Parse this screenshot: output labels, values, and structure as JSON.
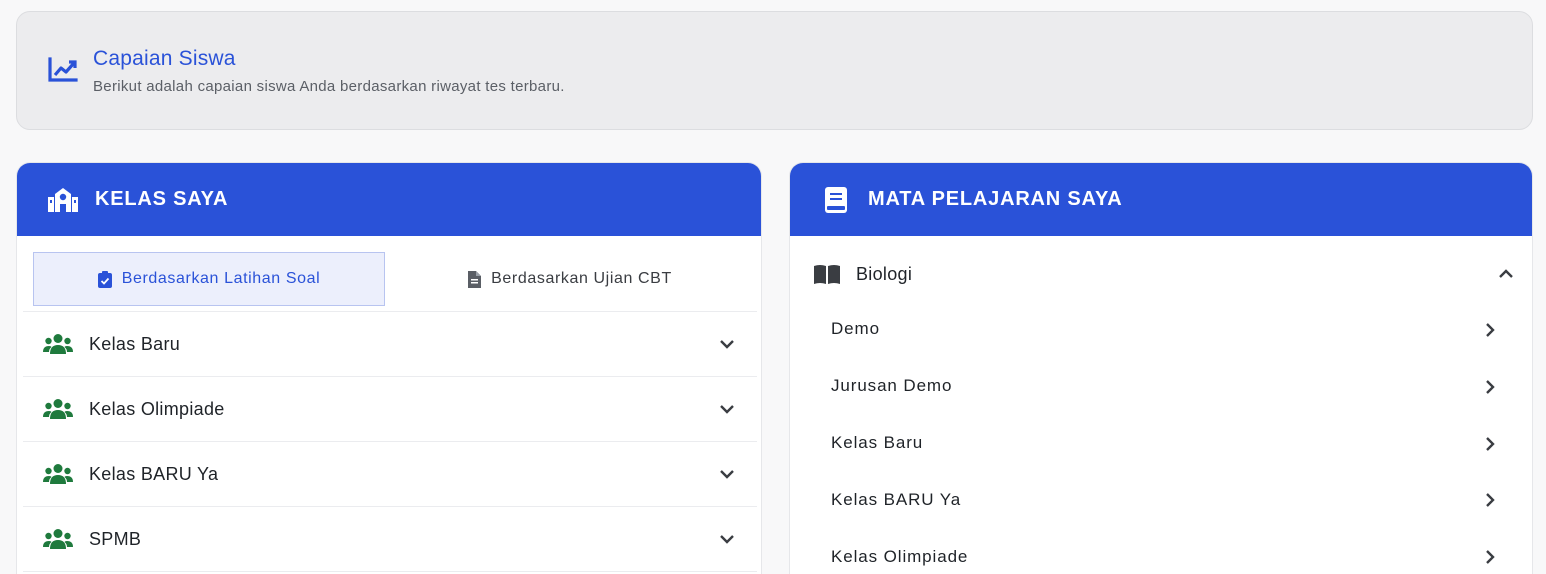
{
  "banner": {
    "icon": "chart-line-icon",
    "title": "Capaian Siswa",
    "subtitle": "Berikut adalah capaian siswa Anda berdasarkan riwayat tes terbaru."
  },
  "kelas_card": {
    "icon": "school-icon",
    "title": "KELAS SAYA",
    "tabs": [
      {
        "label": "Berdasarkan Latihan Soal",
        "icon": "clipboard-check-icon",
        "active": true
      },
      {
        "label": "Berdasarkan Ujian CBT",
        "icon": "file-text-icon",
        "active": false
      }
    ],
    "classes": [
      {
        "label": "Kelas Baru",
        "icon": "users-icon"
      },
      {
        "label": "Kelas Olimpiade",
        "icon": "users-icon"
      },
      {
        "label": "Kelas BARU Ya",
        "icon": "users-icon"
      },
      {
        "label": "SPMB",
        "icon": "users-icon"
      }
    ]
  },
  "mapel_card": {
    "icon": "book-icon",
    "title": "MATA PELAJARAN SAYA",
    "subject": {
      "label": "Biologi",
      "icon": "book-open-icon",
      "expanded": true
    },
    "items": [
      "Demo",
      "Jurusan Demo",
      "Kelas Baru",
      "Kelas BARU Ya",
      "Kelas Olimpiade"
    ]
  },
  "colors": {
    "primary": "#2a52d8",
    "group_icon": "#1f7a3d",
    "banner_bg": "#ececee"
  }
}
